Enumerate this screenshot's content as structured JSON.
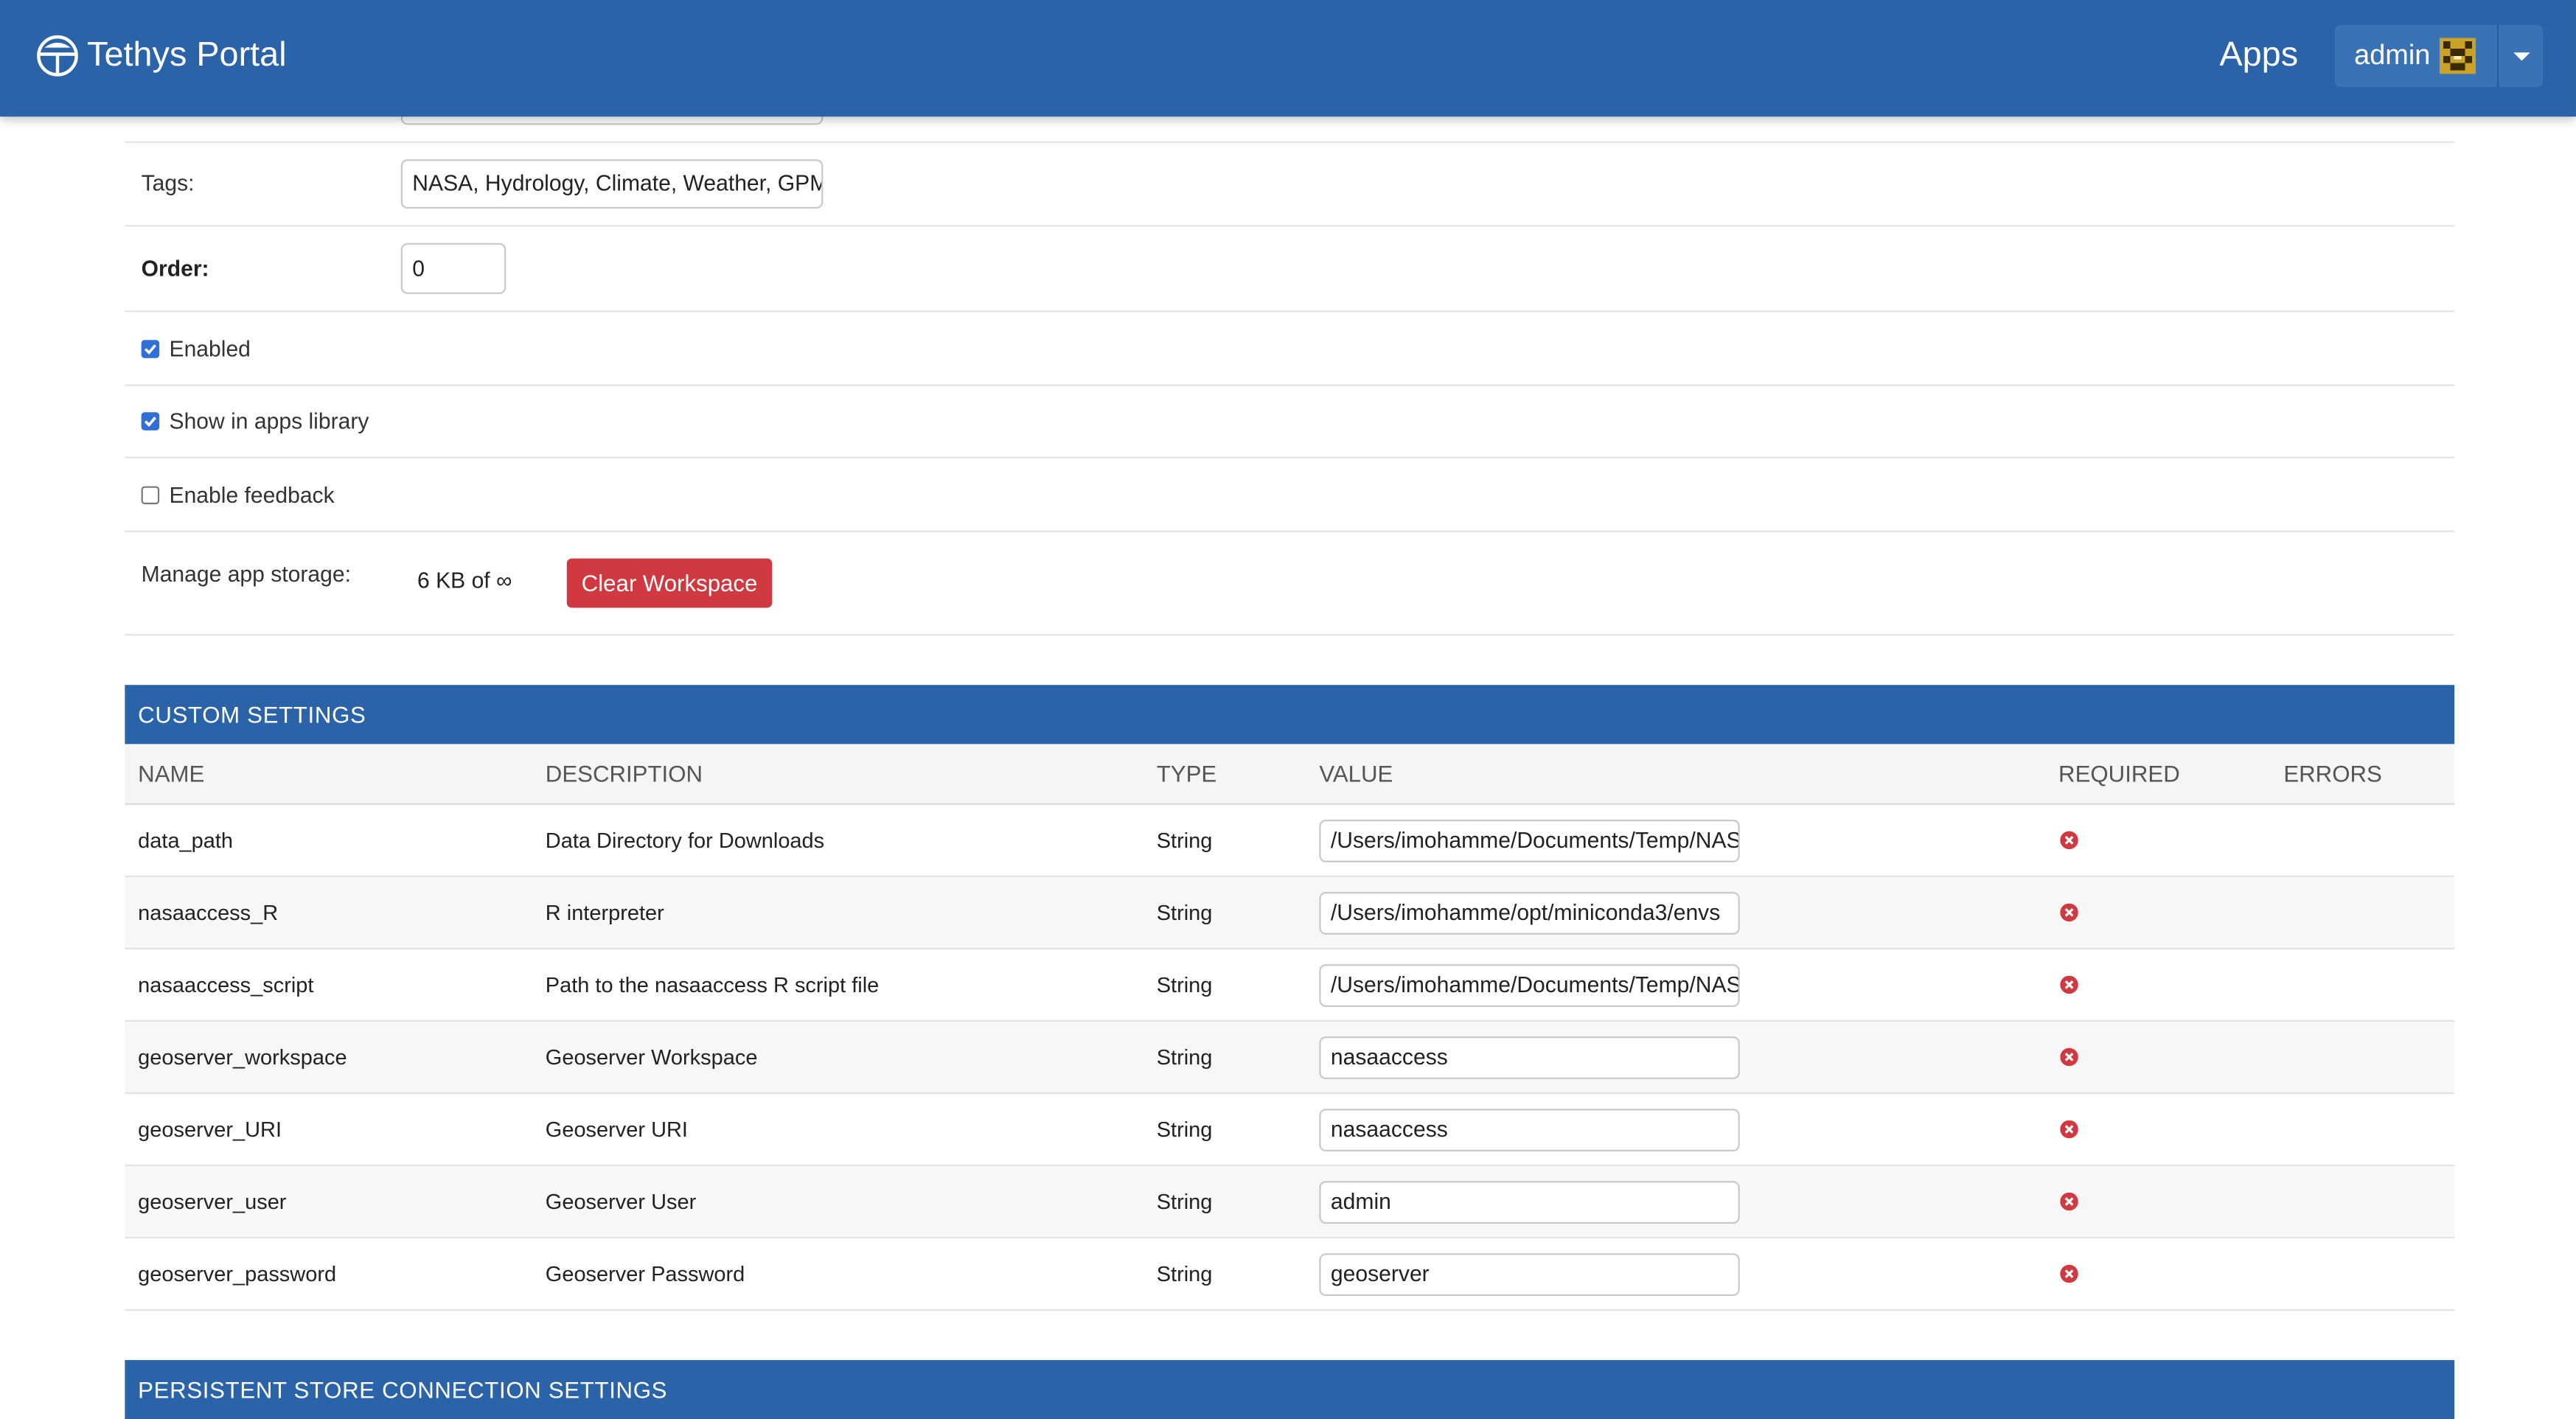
{
  "header": {
    "brand": "Tethys Portal",
    "nav_apps": "Apps",
    "user_name": "admin"
  },
  "form": {
    "tags_label": "Tags:",
    "tags_value": "NASA, Hydrology, Climate, Weather, GPM",
    "order_label": "Order:",
    "order_value": "0",
    "enabled_label": "Enabled",
    "enabled_checked": true,
    "show_in_library_label": "Show in apps library",
    "show_in_library_checked": true,
    "enable_feedback_label": "Enable feedback",
    "enable_feedback_checked": false,
    "storage_label": "Manage app storage:",
    "storage_value": "6 KB of ∞",
    "clear_workspace_label": "Clear Workspace"
  },
  "custom_settings": {
    "title": "CUSTOM SETTINGS",
    "columns": {
      "name": "NAME",
      "description": "DESCRIPTION",
      "type": "TYPE",
      "value": "VALUE",
      "required": "REQUIRED",
      "errors": "ERRORS"
    },
    "rows": [
      {
        "name": "data_path",
        "description": "Data Directory for Downloads",
        "type": "String",
        "value": "/Users/imohamme/Documents/Temp/NASA"
      },
      {
        "name": "nasaaccess_R",
        "description": "R interpreter",
        "type": "String",
        "value": "/Users/imohamme/opt/miniconda3/envs"
      },
      {
        "name": "nasaaccess_script",
        "description": "Path to the nasaaccess R script file",
        "type": "String",
        "value": "/Users/imohamme/Documents/Temp/NASA"
      },
      {
        "name": "geoserver_workspace",
        "description": "Geoserver Workspace",
        "type": "String",
        "value": "nasaaccess"
      },
      {
        "name": "geoserver_URI",
        "description": "Geoserver URI",
        "type": "String",
        "value": "nasaaccess"
      },
      {
        "name": "geoserver_user",
        "description": "Geoserver User",
        "type": "String",
        "value": "admin"
      },
      {
        "name": "geoserver_password",
        "description": "Geoserver Password",
        "type": "String",
        "value": "geoserver"
      }
    ]
  },
  "persistent_store": {
    "title": "PERSISTENT STORE CONNECTION SETTINGS"
  },
  "colors": {
    "brand_blue": "#2a63a8",
    "danger_red": "#d0393f",
    "required_icon_red": "#d0393f",
    "checkbox_blue": "#2f6fd6"
  },
  "icons": {
    "logo": "tethys-logo-icon",
    "avatar": "user-avatar-icon",
    "dropdown": "caret-down-icon",
    "required": "x-circle-icon"
  }
}
